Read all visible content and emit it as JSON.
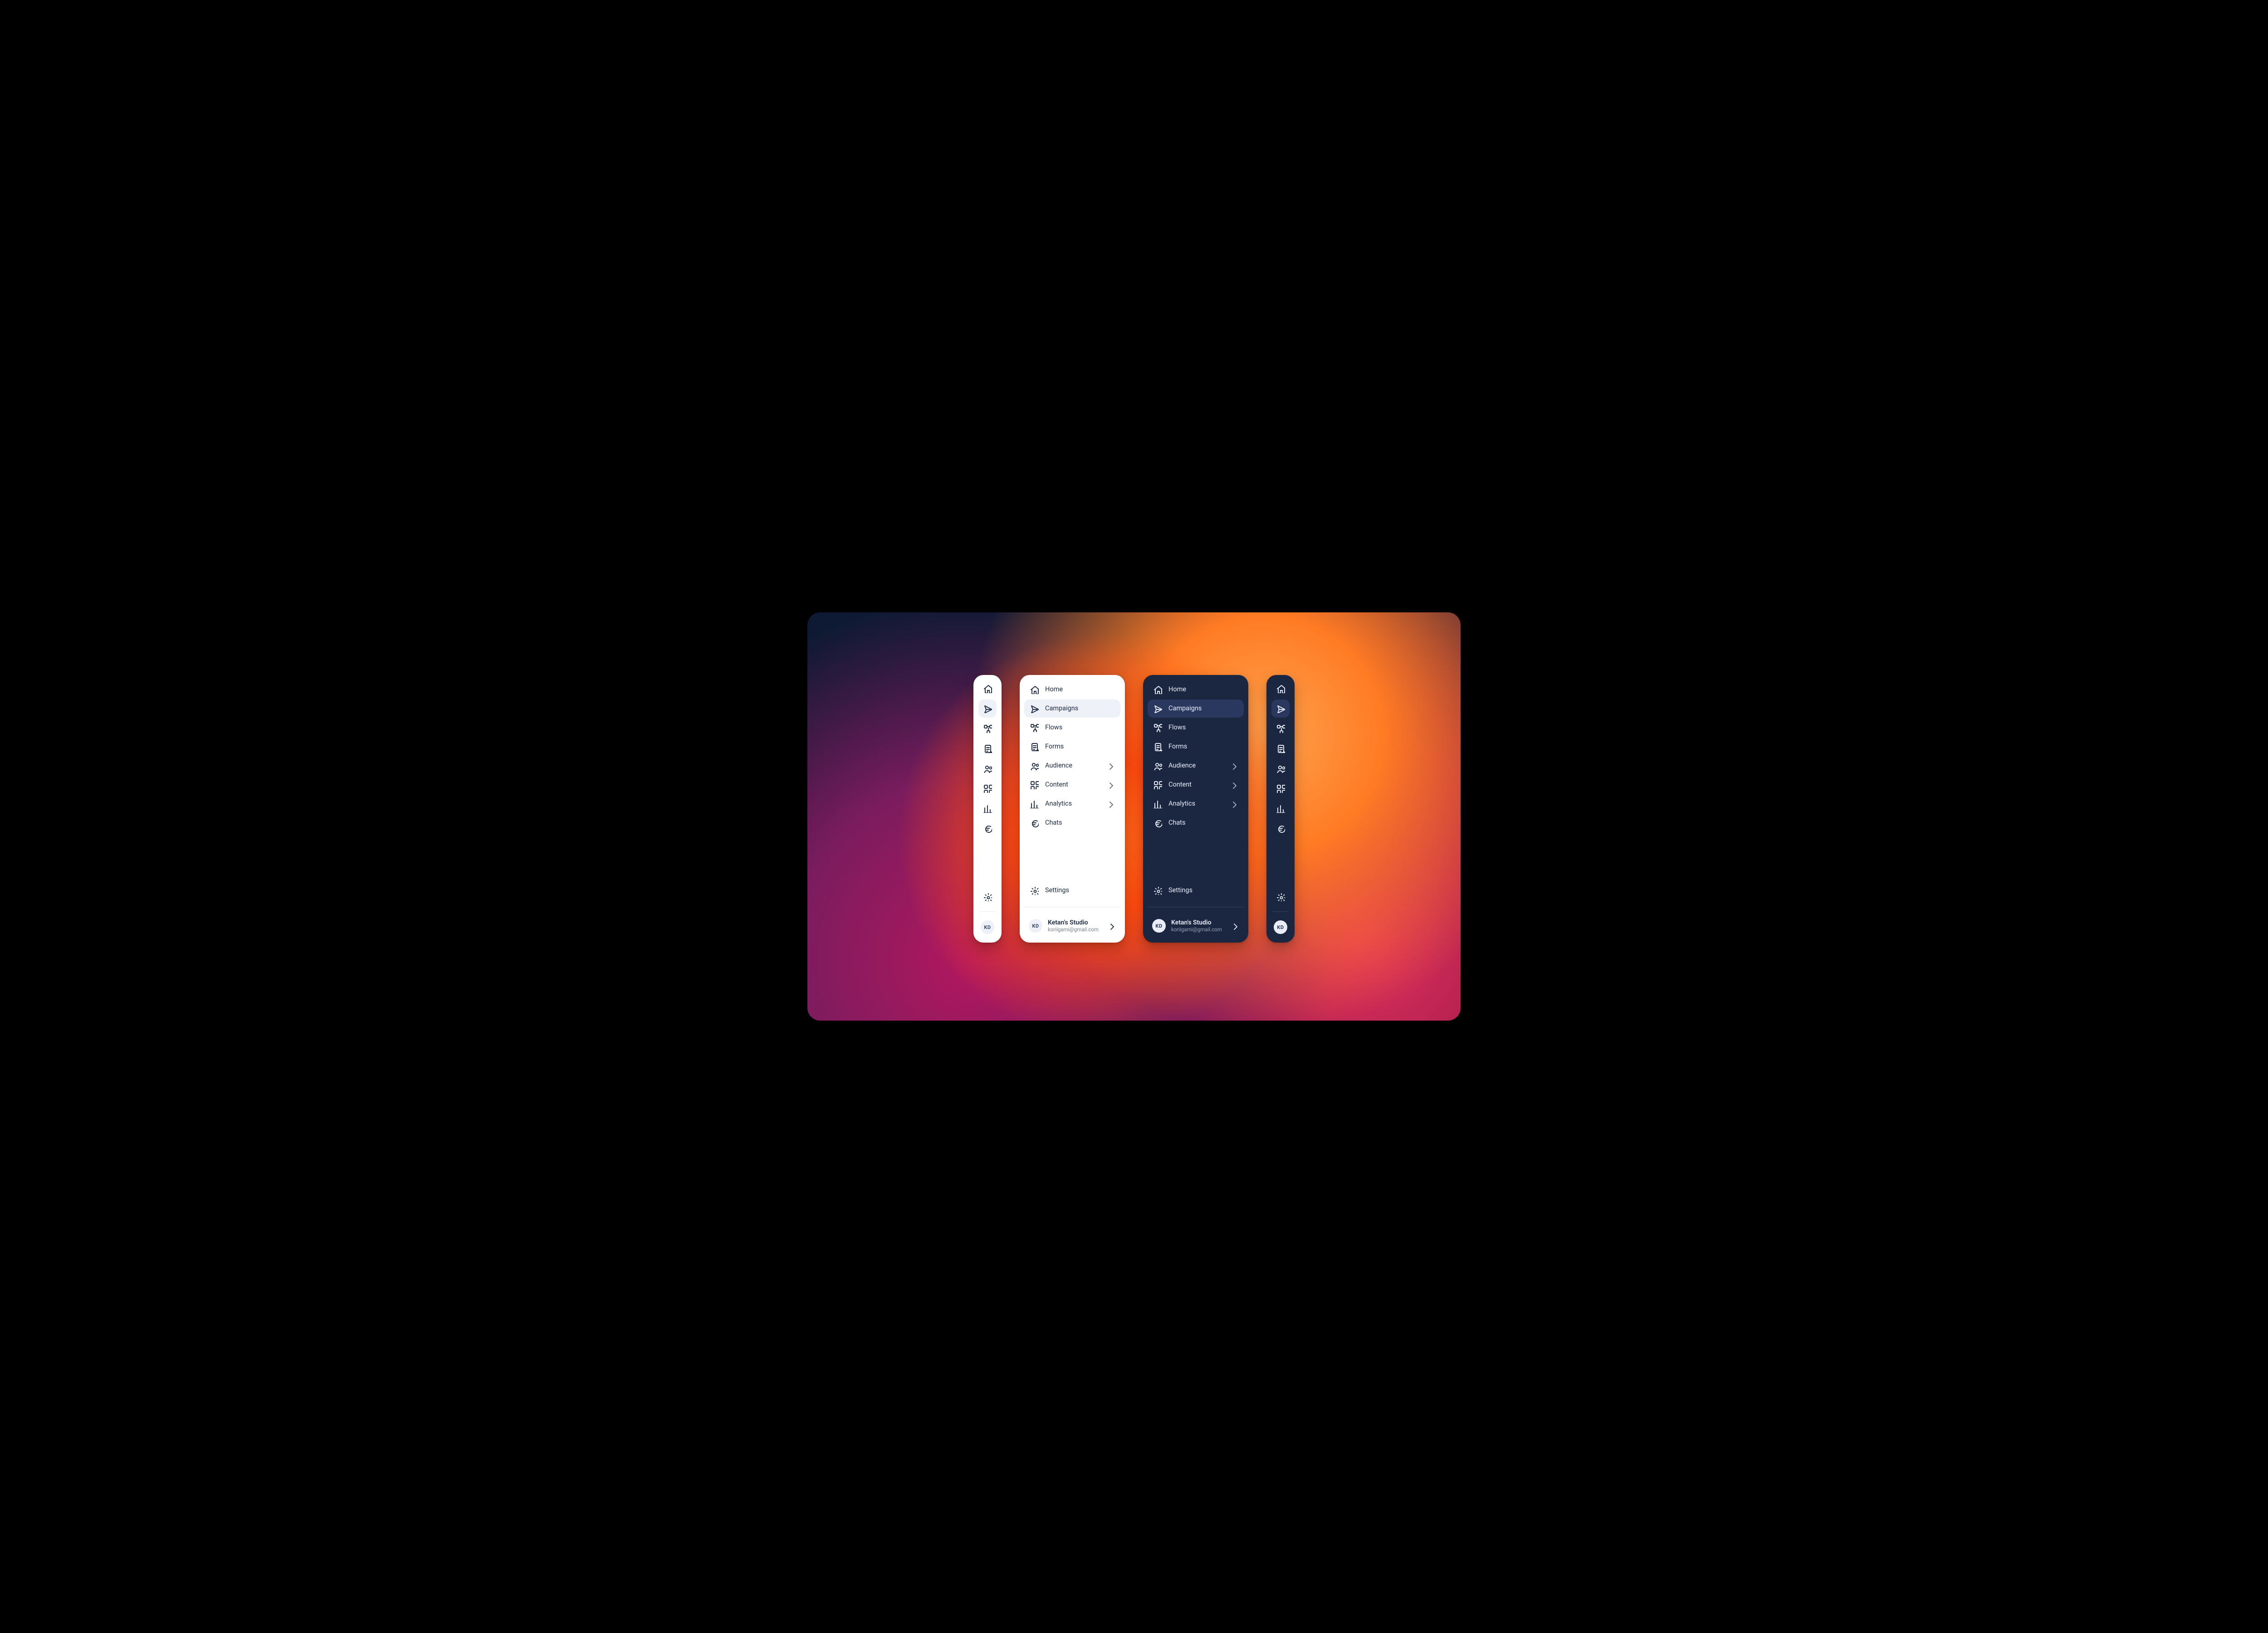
{
  "nav": {
    "items": [
      {
        "key": "home",
        "label": "Home",
        "icon": "home-icon",
        "expandable": false
      },
      {
        "key": "campaigns",
        "label": "Campaigns",
        "icon": "send-icon",
        "expandable": false
      },
      {
        "key": "flows",
        "label": "Flows",
        "icon": "flows-icon",
        "expandable": false
      },
      {
        "key": "forms",
        "label": "Forms",
        "icon": "forms-icon",
        "expandable": false
      },
      {
        "key": "audience",
        "label": "Audience",
        "icon": "audience-icon",
        "expandable": true
      },
      {
        "key": "content",
        "label": "Content",
        "icon": "content-icon",
        "expandable": true
      },
      {
        "key": "analytics",
        "label": "Analytics",
        "icon": "analytics-icon",
        "expandable": true
      },
      {
        "key": "chats",
        "label": "Chats",
        "icon": "chats-icon",
        "expandable": false
      }
    ],
    "active_key": "campaigns",
    "settings": {
      "label": "Settings",
      "icon": "settings-icon"
    }
  },
  "user": {
    "workspace_name": "Ketan's Studio",
    "email": "koriigami@gmail.com",
    "initials": "KD"
  },
  "themes": {
    "light": {
      "bg": "#ffffff",
      "fg": "#1d2b46",
      "active_bg": "#eef1f7",
      "divider": "#e5e9f1",
      "avatar_bg": "#edf0f6",
      "avatar_fg": "#394b6b"
    },
    "dark": {
      "bg": "#1b2640",
      "fg": "#e6ecf8",
      "active_bg": "#2a3860",
      "divider": "rgba(255,255,255,.12)",
      "avatar_bg": "#e8edf7",
      "avatar_fg": "#2b3957"
    }
  }
}
